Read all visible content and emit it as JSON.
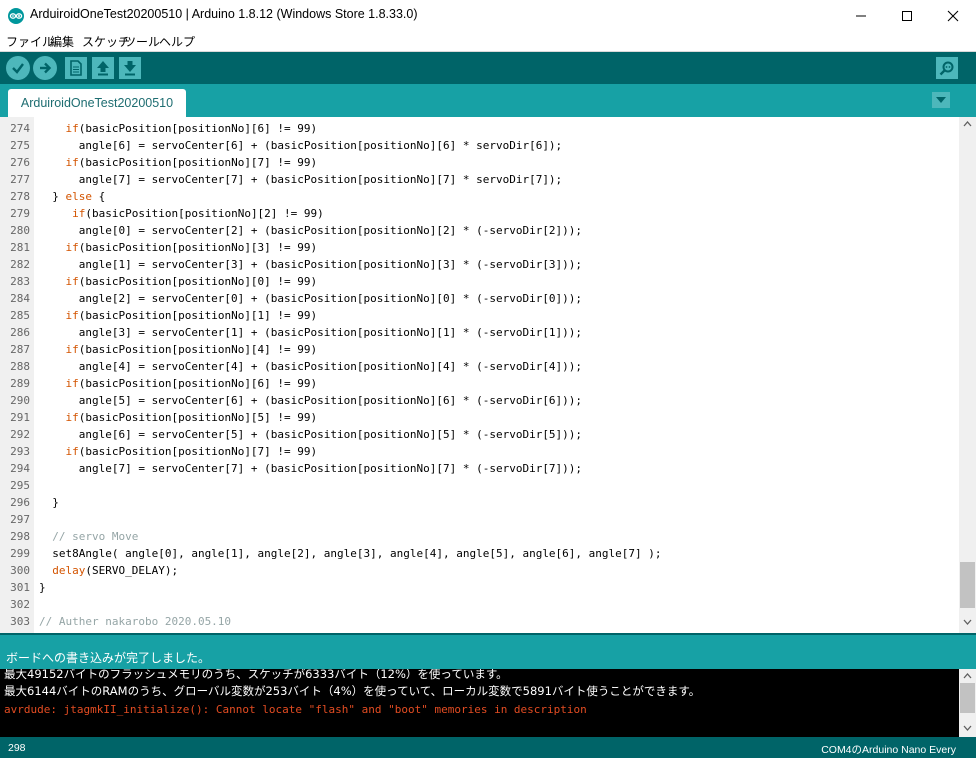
{
  "window": {
    "title": "ArduiroidOneTest20200510 | Arduino 1.8.12 (Windows Store 1.8.33.0)",
    "icon": "arduino-logo-icon",
    "controls": [
      "minimize-icon",
      "maximize-icon",
      "close-icon"
    ]
  },
  "menu": [
    "ファイル",
    "編集",
    "スケッチ",
    "ツール",
    "ヘルプ"
  ],
  "toolbar": {
    "buttons": [
      "verify-icon",
      "upload-icon",
      "new-icon",
      "open-icon",
      "save-icon"
    ],
    "right": "serial-monitor-icon"
  },
  "tabs": [
    {
      "label": "ArduiroidOneTest20200510",
      "active": true
    }
  ],
  "tab_menu_icon": "chevron-down-icon",
  "editor": {
    "lines": [
      {
        "n": "274",
        "text": "    if(basicPosition[positionNo][6] != 99)"
      },
      {
        "n": "275",
        "text": "      angle[6] = servoCenter[6] + (basicPosition[positionNo][6] * servoDir[6]);"
      },
      {
        "n": "276",
        "text": "    if(basicPosition[positionNo][7] != 99)"
      },
      {
        "n": "277",
        "text": "      angle[7] = servoCenter[7] + (basicPosition[positionNo][7] * servoDir[7]);"
      },
      {
        "n": "278",
        "text": "  } else {"
      },
      {
        "n": "279",
        "text": "     if(basicPosition[positionNo][2] != 99)"
      },
      {
        "n": "280",
        "text": "      angle[0] = servoCenter[2] + (basicPosition[positionNo][2] * (-servoDir[2]));"
      },
      {
        "n": "281",
        "text": "    if(basicPosition[positionNo][3] != 99)"
      },
      {
        "n": "282",
        "text": "      angle[1] = servoCenter[3] + (basicPosition[positionNo][3] * (-servoDir[3]));"
      },
      {
        "n": "283",
        "text": "    if(basicPosition[positionNo][0] != 99)"
      },
      {
        "n": "284",
        "text": "      angle[2] = servoCenter[0] + (basicPosition[positionNo][0] * (-servoDir[0]));"
      },
      {
        "n": "285",
        "text": "    if(basicPosition[positionNo][1] != 99)"
      },
      {
        "n": "286",
        "text": "      angle[3] = servoCenter[1] + (basicPosition[positionNo][1] * (-servoDir[1]));"
      },
      {
        "n": "287",
        "text": "    if(basicPosition[positionNo][4] != 99)"
      },
      {
        "n": "288",
        "text": "      angle[4] = servoCenter[4] + (basicPosition[positionNo][4] * (-servoDir[4]));"
      },
      {
        "n": "289",
        "text": "    if(basicPosition[positionNo][6] != 99)"
      },
      {
        "n": "290",
        "text": "      angle[5] = servoCenter[6] + (basicPosition[positionNo][6] * (-servoDir[6]));"
      },
      {
        "n": "291",
        "text": "    if(basicPosition[positionNo][5] != 99)"
      },
      {
        "n": "292",
        "text": "      angle[6] = servoCenter[5] + (basicPosition[positionNo][5] * (-servoDir[5]));"
      },
      {
        "n": "293",
        "text": "    if(basicPosition[positionNo][7] != 99)"
      },
      {
        "n": "294",
        "text": "      angle[7] = servoCenter[7] + (basicPosition[positionNo][7] * (-servoDir[7]));"
      },
      {
        "n": "295",
        "text": ""
      },
      {
        "n": "296",
        "text": "  }"
      },
      {
        "n": "297",
        "text": ""
      },
      {
        "n": "298",
        "text": "  // servo Move"
      },
      {
        "n": "299",
        "text": "  set8Angle( angle[0], angle[1], angle[2], angle[3], angle[4], angle[5], angle[6], angle[7] );"
      },
      {
        "n": "300",
        "text": "  delay(SERVO_DELAY);"
      },
      {
        "n": "301",
        "text": "}"
      },
      {
        "n": "302",
        "text": ""
      },
      {
        "n": "303",
        "text": "// Auther nakarobo 2020.05.10"
      }
    ]
  },
  "status": {
    "message": "ボードへの書き込みが完了しました。"
  },
  "console": {
    "lines": [
      {
        "text": "最大49152バイトのフラッシュメモリのうち、スケッチが6333バイト（12%）を使っています。",
        "color": "#ffffff"
      },
      {
        "text": "最大6144バイトのRAMのうち、グローバル変数が253バイト（4%）を使っていて、ローカル変数で5891バイト使うことができます。",
        "color": "#ffffff"
      },
      {
        "text": "avrdude: jtagmkII_initialize(): Cannot locate \"flash\" and \"boot\" memories in description",
        "color": "#e34c22"
      }
    ]
  },
  "footer": {
    "line": "298",
    "board": "COM4のArduino Nano Every"
  },
  "colors": {
    "dark_teal": "#006468",
    "teal": "#17a1a5",
    "button": "#4db7bb",
    "error": "#e34c22"
  }
}
